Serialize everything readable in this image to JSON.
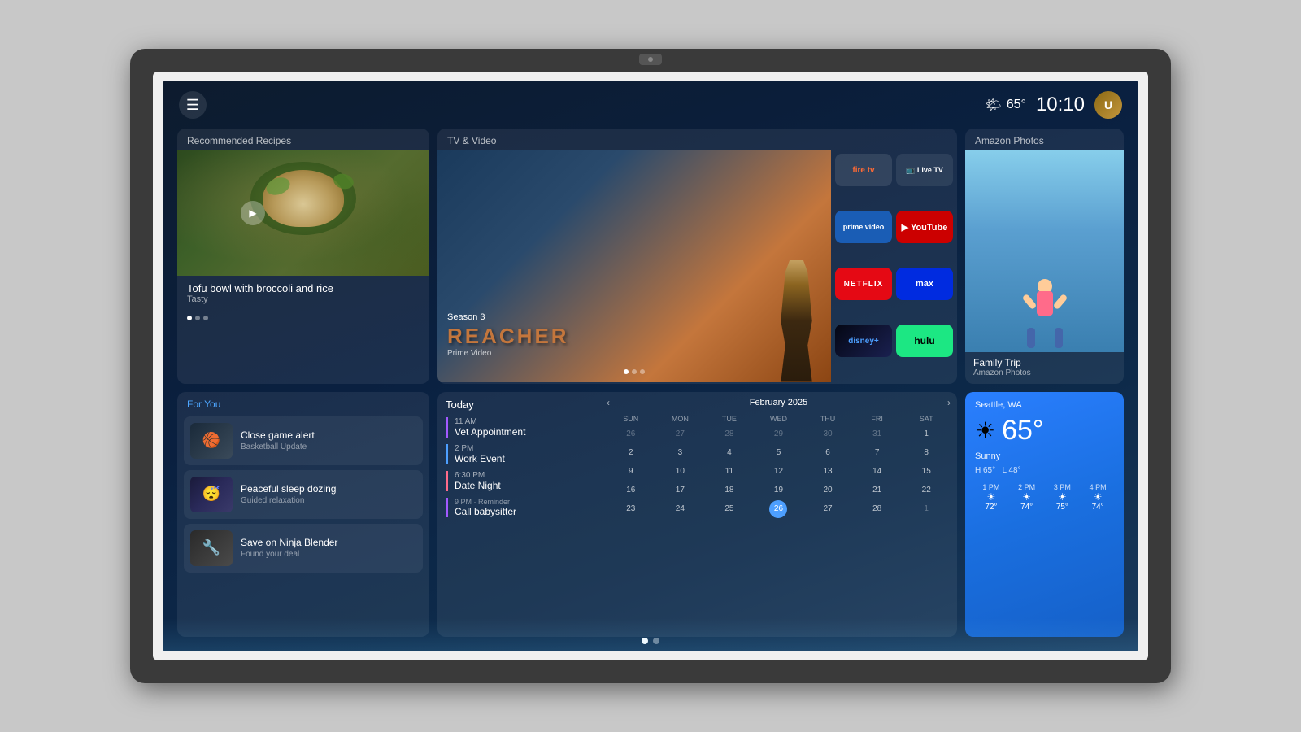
{
  "device": {
    "camera_label": "camera"
  },
  "header": {
    "menu_icon": "☰",
    "weather_icon": "🌤",
    "temperature": "65°",
    "time": "10:10",
    "avatar_initials": "U"
  },
  "recipes": {
    "section_label": "Recommended Recipes",
    "title": "Tofu bowl with broccoli and rice",
    "subtitle": "Tasty",
    "play_icon": "▶"
  },
  "tv": {
    "section_label": "TV & Video",
    "show_title": "REACHER",
    "season": "Season 3",
    "platform": "Prime Video",
    "apps": [
      {
        "id": "firetv",
        "label": "fire tv"
      },
      {
        "id": "livetv",
        "label": "📺 Live TV"
      },
      {
        "id": "prime",
        "label": "prime video"
      },
      {
        "id": "youtube",
        "label": "▶ YouTube"
      },
      {
        "id": "netflix",
        "label": "NETFLIX"
      },
      {
        "id": "max",
        "label": "max"
      },
      {
        "id": "disney",
        "label": "disney+"
      },
      {
        "id": "hulu",
        "label": "hulu"
      }
    ]
  },
  "photos": {
    "section_label": "Amazon Photos",
    "album_title": "Family Trip",
    "album_source": "Amazon Photos"
  },
  "foryou": {
    "section_label": "For You",
    "items": [
      {
        "id": "basketball",
        "title": "Close game alert",
        "subtitle": "Basketball Update",
        "icon": "🏀"
      },
      {
        "id": "sleep",
        "title": "Peaceful sleep dozing",
        "subtitle": "Guided relaxation",
        "icon": "😴"
      },
      {
        "id": "blender",
        "title": "Save on Ninja Blender",
        "subtitle": "Found your deal",
        "icon": "🔧"
      }
    ]
  },
  "today": {
    "section_label": "Today",
    "events": [
      {
        "time": "11 AM",
        "name": "Vet Appointment",
        "color": "purple"
      },
      {
        "time": "2 PM",
        "name": "Work Event",
        "color": "blue"
      },
      {
        "time": "6:30 PM",
        "name": "Date Night",
        "color": "pink"
      },
      {
        "time": "9 PM · Reminder",
        "name": "Call babysitter",
        "color": "reminder"
      }
    ]
  },
  "calendar": {
    "month_year": "February 2025",
    "day_headers": [
      "SUN",
      "MON",
      "TUE",
      "WED",
      "THU",
      "FRI",
      "SAT"
    ],
    "rows": [
      [
        "26",
        "27",
        "28",
        "29",
        "30",
        "31",
        "1"
      ],
      [
        "2",
        "3",
        "4",
        "5",
        "6",
        "7",
        "8"
      ],
      [
        "9",
        "10",
        "11",
        "12",
        "13",
        "14",
        "15"
      ],
      [
        "16",
        "17",
        "18",
        "19",
        "20",
        "21",
        "22"
      ],
      [
        "23",
        "24",
        "25",
        "26",
        "27",
        "28",
        "1"
      ]
    ],
    "today_date": "26",
    "other_month_start": [
      "26",
      "27",
      "28",
      "29",
      "30",
      "31"
    ],
    "other_month_end": [
      "1"
    ]
  },
  "weather": {
    "location": "Seattle, WA",
    "temp": "65°",
    "icon": "☀",
    "condition": "Sunny",
    "high": "H 65°",
    "low": "L 48°",
    "hourly": [
      {
        "time": "1 PM",
        "icon": "☀",
        "temp": "72°"
      },
      {
        "time": "2 PM",
        "icon": "☀",
        "temp": "74°"
      },
      {
        "time": "3 PM",
        "icon": "☀",
        "temp": "75°"
      },
      {
        "time": "4 PM",
        "icon": "☀",
        "temp": "74°"
      }
    ]
  },
  "page_dots": [
    {
      "active": true
    },
    {
      "active": false
    }
  ]
}
